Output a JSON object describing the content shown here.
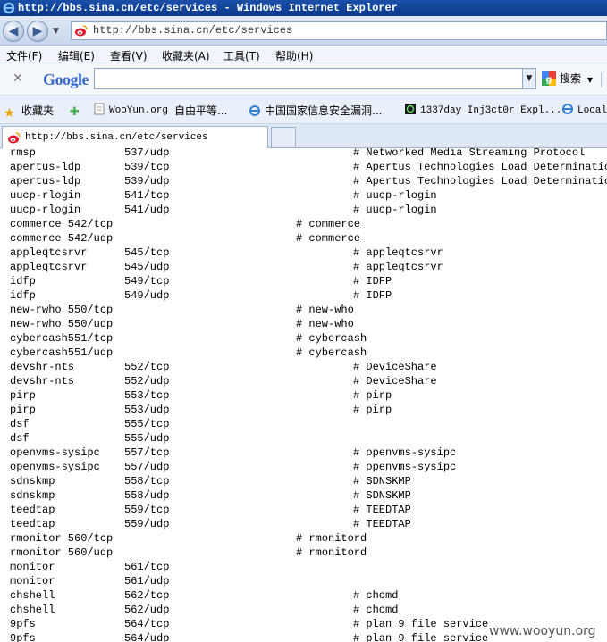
{
  "window": {
    "title": "http://bbs.sina.cn/etc/services - Windows Internet Explorer"
  },
  "address": {
    "url": "http://bbs.sina.cn/etc/services"
  },
  "menu": [
    "文件(F)",
    "编辑(E)",
    "查看(V)",
    "收藏夹(A)",
    "工具(T)",
    "帮助(H)"
  ],
  "google_toolbar": {
    "logo": "Google",
    "search_value": "",
    "search_button": "搜索"
  },
  "favorites": {
    "label": "收藏夹",
    "items": [
      "WooYun.org",
      "自由平等...",
      "中国国家信息安全漏洞...",
      "1337day Inj3ct0r Expl...",
      "Local_"
    ]
  },
  "tab": {
    "label": "http://bbs.sina.cn/etc/services"
  },
  "colors": {
    "titlebar": "#0b3a8c",
    "accent": "#1b4fa8"
  },
  "services": [
    {
      "name": "rmsp",
      "port": "537/udp",
      "comment": "# Networked Media Streaming Protocol"
    },
    {
      "name": "apertus-ldp",
      "port": "539/tcp",
      "comment": "# Apertus Technologies Load Determination"
    },
    {
      "name": "apertus-ldp",
      "port": "539/udp",
      "comment": "# Apertus Technologies Load Determination"
    },
    {
      "name": "uucp-rlogin",
      "port": "541/tcp",
      "comment": "# uucp-rlogin"
    },
    {
      "name": "uucp-rlogin",
      "port": "541/udp",
      "comment": "# uucp-rlogin"
    },
    {
      "name": "commerce 542/tcp",
      "port": "",
      "comment": "# commerce",
      "wide": true
    },
    {
      "name": "commerce 542/udp",
      "port": "",
      "comment": "# commerce",
      "wide": true
    },
    {
      "name": "appleqtcsrvr",
      "port": "545/tcp",
      "comment": "# appleqtcsrvr"
    },
    {
      "name": "appleqtcsrvr",
      "port": "545/udp",
      "comment": "# appleqtcsrvr"
    },
    {
      "name": "idfp",
      "port": "549/tcp",
      "comment": "# IDFP"
    },
    {
      "name": "idfp",
      "port": "549/udp",
      "comment": "# IDFP"
    },
    {
      "name": "new-rwho 550/tcp",
      "port": "",
      "comment": "# new-who",
      "wide": true
    },
    {
      "name": "new-rwho 550/udp",
      "port": "",
      "comment": "# new-who",
      "wide": true
    },
    {
      "name": "cybercash551/tcp",
      "port": "",
      "comment": "# cybercash",
      "wide": true
    },
    {
      "name": "cybercash551/udp",
      "port": "",
      "comment": "# cybercash",
      "wide": true
    },
    {
      "name": "devshr-nts",
      "port": "552/tcp",
      "comment": "# DeviceShare"
    },
    {
      "name": "devshr-nts",
      "port": "552/udp",
      "comment": "# DeviceShare"
    },
    {
      "name": "pirp",
      "port": "553/tcp",
      "comment": "# pirp"
    },
    {
      "name": "pirp",
      "port": "553/udp",
      "comment": "# pirp"
    },
    {
      "name": "dsf",
      "port": "555/tcp",
      "comment": ""
    },
    {
      "name": "dsf",
      "port": "555/udp",
      "comment": ""
    },
    {
      "name": "openvms-sysipc",
      "port": "557/tcp",
      "comment": "# openvms-sysipc"
    },
    {
      "name": "openvms-sysipc",
      "port": "557/udp",
      "comment": "# openvms-sysipc"
    },
    {
      "name": "sdnskmp",
      "port": "558/tcp",
      "comment": "# SDNSKMP"
    },
    {
      "name": "sdnskmp",
      "port": "558/udp",
      "comment": "# SDNSKMP"
    },
    {
      "name": "teedtap",
      "port": "559/tcp",
      "comment": "# TEEDTAP"
    },
    {
      "name": "teedtap",
      "port": "559/udp",
      "comment": "# TEEDTAP"
    },
    {
      "name": "rmonitor 560/tcp",
      "port": "",
      "comment": "# rmonitord",
      "wide": true
    },
    {
      "name": "rmonitor 560/udp",
      "port": "",
      "comment": "# rmonitord",
      "wide": true
    },
    {
      "name": "monitor",
      "port": "561/tcp",
      "comment": ""
    },
    {
      "name": "monitor",
      "port": "561/udp",
      "comment": ""
    },
    {
      "name": "chshell",
      "port": "562/tcp",
      "comment": "# chcmd"
    },
    {
      "name": "chshell",
      "port": "562/udp",
      "comment": "# chcmd"
    },
    {
      "name": "9pfs",
      "port": "564/tcp",
      "comment": "# plan 9 file service"
    },
    {
      "name": "9pfs",
      "port": "564/udp",
      "comment": "# plan 9 file service"
    }
  ],
  "watermark": "www.wooyun.org"
}
